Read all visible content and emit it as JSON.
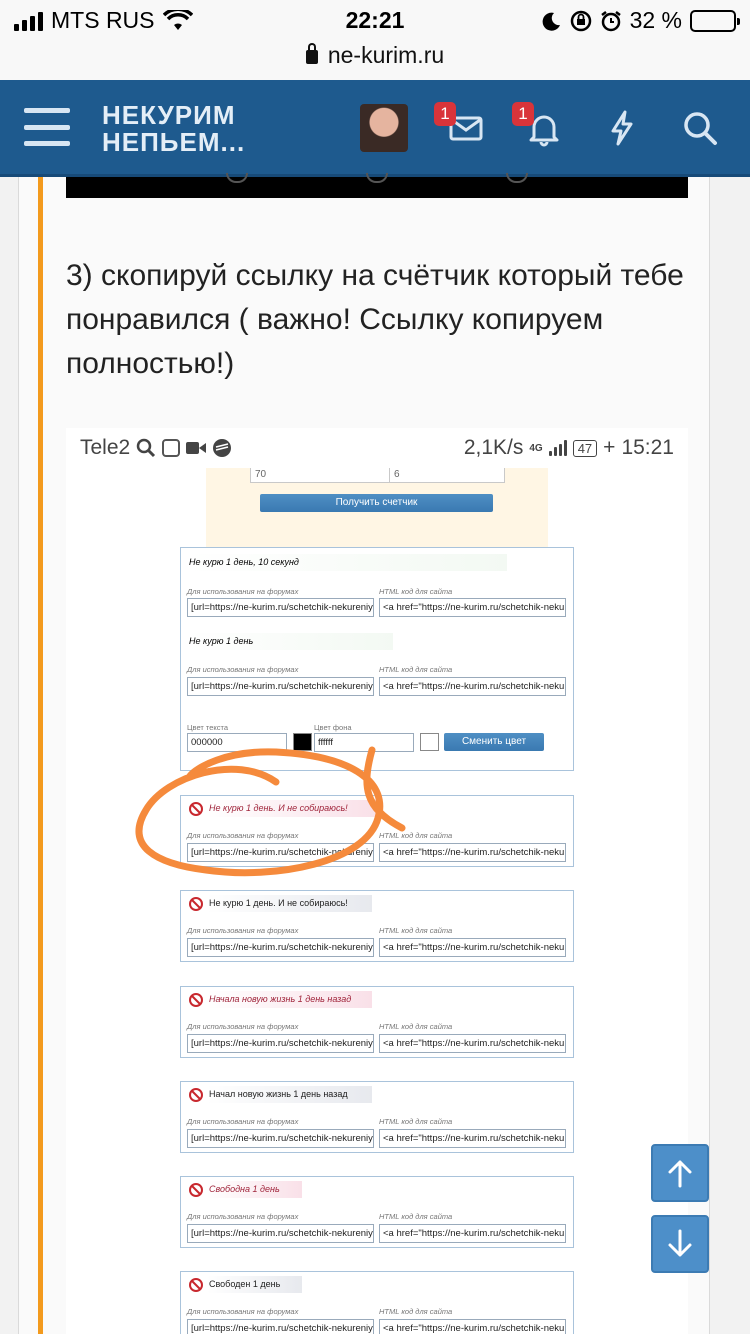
{
  "status_bar": {
    "carrier": "MTS RUS",
    "time": "22:21",
    "battery": "32 %",
    "battery_level": 0.32
  },
  "browser": {
    "url": "ne-kurim.ru"
  },
  "header": {
    "logo_line1": "НЕКУРИМ",
    "logo_line2": "НЕПЬЕМ...",
    "messages_badge": "1",
    "alerts_badge": "1"
  },
  "post": {
    "text": "3) скопируй ссылку на счётчик который тебе понравился ( важно! Ссылку копируем полностью!)"
  },
  "screenshot": {
    "status": {
      "carrier": "Tele2",
      "speed": "2,1K/s",
      "network": "4G",
      "battery": "47",
      "time": "15:21"
    },
    "form": {
      "input1": "70",
      "input2": "6",
      "get_button": "Получить счетчик"
    },
    "caption_forum": "Для использования на форумах",
    "caption_html": "HTML код для сайта",
    "bbcode": "[url=https://ne-kurim.ru/schetchik-nekureniy",
    "htmlcode": "<a href=\"https://ne-kurim.ru/schetchik-neku",
    "counters": [
      {
        "title": "Не курю 1 день, 10 секунд"
      },
      {
        "title": "Не курю 1 день"
      },
      {
        "title": "Не курю 1 день. И не собираюсь!"
      },
      {
        "title": "Не курю 1 день. И не собираюсь!"
      },
      {
        "title": "Начала новую жизнь 1 день назад"
      },
      {
        "title": "Начал новую жизнь 1 день назад"
      },
      {
        "title": "Свободна 1 день"
      },
      {
        "title": "Свободен 1 день"
      }
    ],
    "colors": {
      "text_label": "Цвет текста",
      "bg_label": "Цвет фона",
      "text_value": "000000",
      "bg_value": "ffffff",
      "change_button": "Сменить цвет"
    }
  },
  "colors": {
    "header": "#1e5a8e",
    "accent": "#f39a1d",
    "badge": "#d9343a",
    "scroll_button": "#4d8fc9",
    "annotation": "#f58a3c"
  }
}
